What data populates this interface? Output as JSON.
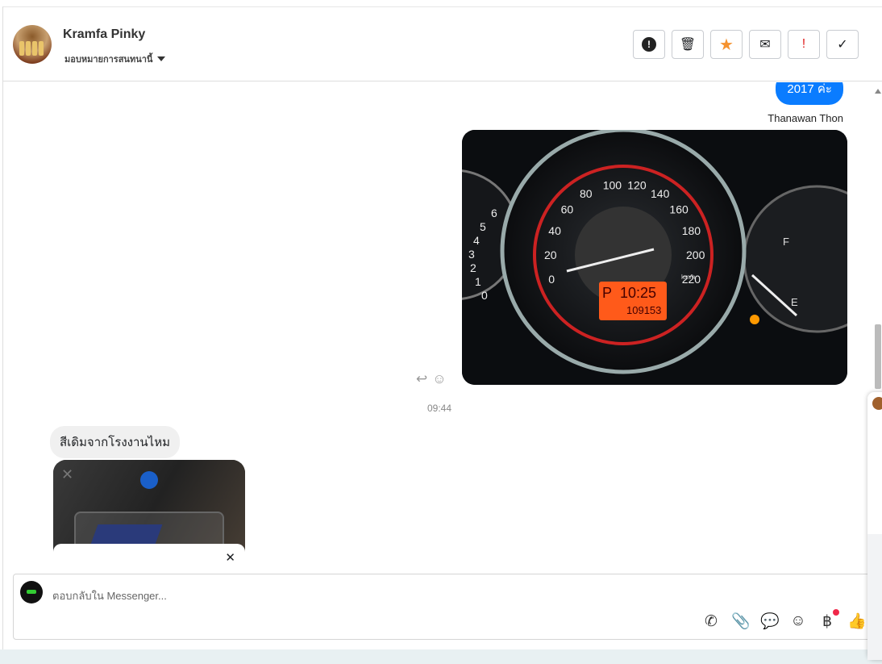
{
  "header": {
    "contact_name": "Kramfa Pinky",
    "assign_label": "มอบหมายการสนทนานี้",
    "tools": [
      {
        "name": "spam",
        "glyph": "❗"
      },
      {
        "name": "delete",
        "glyph": "🗑"
      },
      {
        "name": "star",
        "glyph": "★"
      },
      {
        "name": "mark-unread",
        "glyph": "✉"
      },
      {
        "name": "important",
        "glyph": "!"
      },
      {
        "name": "done",
        "glyph": "✓"
      }
    ]
  },
  "messages": {
    "outgoing_text": "2017 ค่ะ",
    "sender": "Thanawan Thon",
    "time": "09:44",
    "incoming_text": "สีเดิมจากโรงงานไหม",
    "dash": {
      "speed_ticks": [
        "0",
        "20",
        "40",
        "60",
        "80",
        "100",
        "120",
        "140",
        "160",
        "180",
        "200",
        "220"
      ],
      "gear": "P",
      "clock": "10:25",
      "odo": "109153",
      "unit": "km/h",
      "tach_ticks": [
        "0",
        "1",
        "2",
        "3",
        "4",
        "5",
        "6"
      ],
      "fuel_f": "F",
      "fuel_e": "E"
    }
  },
  "composer": {
    "placeholder": "ตอบกลับใน Messenger...",
    "baht": "฿"
  },
  "colors": {
    "accent": "#0a7cff",
    "star": "#f5922f",
    "important": "#e02020"
  }
}
